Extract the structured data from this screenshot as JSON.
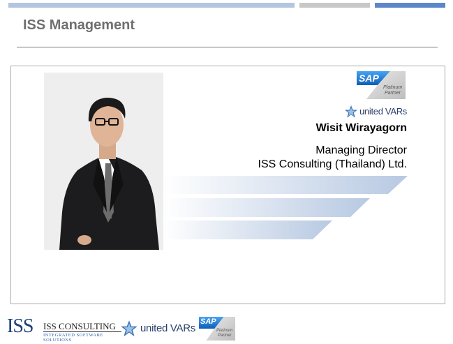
{
  "header": {
    "title": "ISS Management"
  },
  "profile": {
    "name": "Wisit Wirayagorn",
    "position": "Managing Director",
    "company": "ISS Consulting (Thailand) Ltd."
  },
  "logos": {
    "sap_text": "SAP",
    "sap_tagline_1": "Platinum",
    "sap_tagline_2": "Partner",
    "united_vars": "united VARs",
    "iss_mark": "ISS",
    "iss_name": "ISS CONSULTING",
    "iss_tagline": "INTEGRATED SOFTWARE SOLUTIONS"
  },
  "colors": {
    "accent_blue": "#5b87c8",
    "light_blue": "#b3c5e0",
    "gray_bar": "#c8c8c8",
    "title_gray": "#6f6f6f",
    "sap_blue": "#1e7bd6"
  },
  "icons": {
    "united_vars_star": "star-icon"
  }
}
